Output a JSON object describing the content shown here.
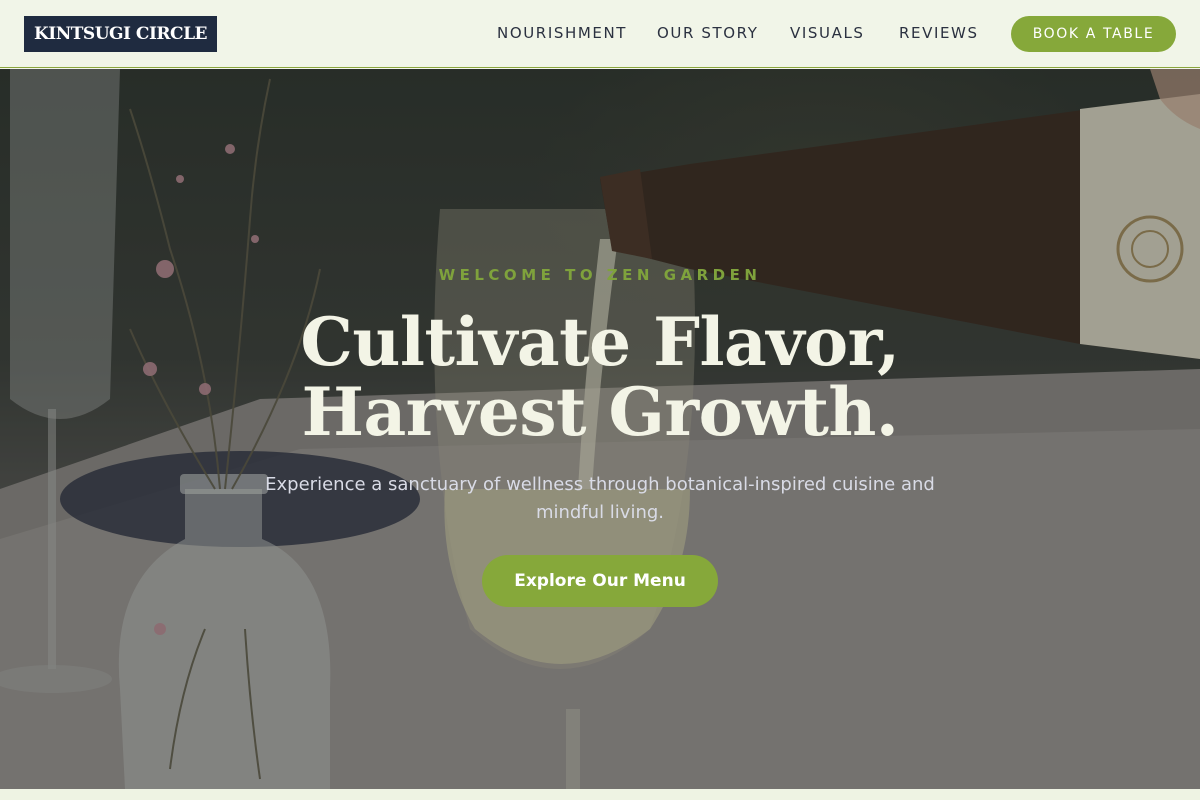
{
  "header": {
    "logo": "KINTSUGI CIRCLE",
    "nav": [
      "NOURISHMENT",
      "OUR STORY",
      "VISUALS",
      "REVIEWS"
    ],
    "cta_label": "BOOK A TABLE"
  },
  "hero": {
    "eyebrow": "WELCOME TO ZEN GARDEN",
    "headline_line1": "Cultivate Flavor,",
    "headline_line2": "Harvest Growth.",
    "subtext": "Experience a sanctuary of wellness through botanical-inspired cuisine and mindful living.",
    "cta_label": "Explore Our Menu"
  },
  "colors": {
    "accent": "#86a83a",
    "logo_bg": "#1f2b40",
    "header_bg": "#f1f5e8",
    "headline": "#f3f4e6"
  }
}
